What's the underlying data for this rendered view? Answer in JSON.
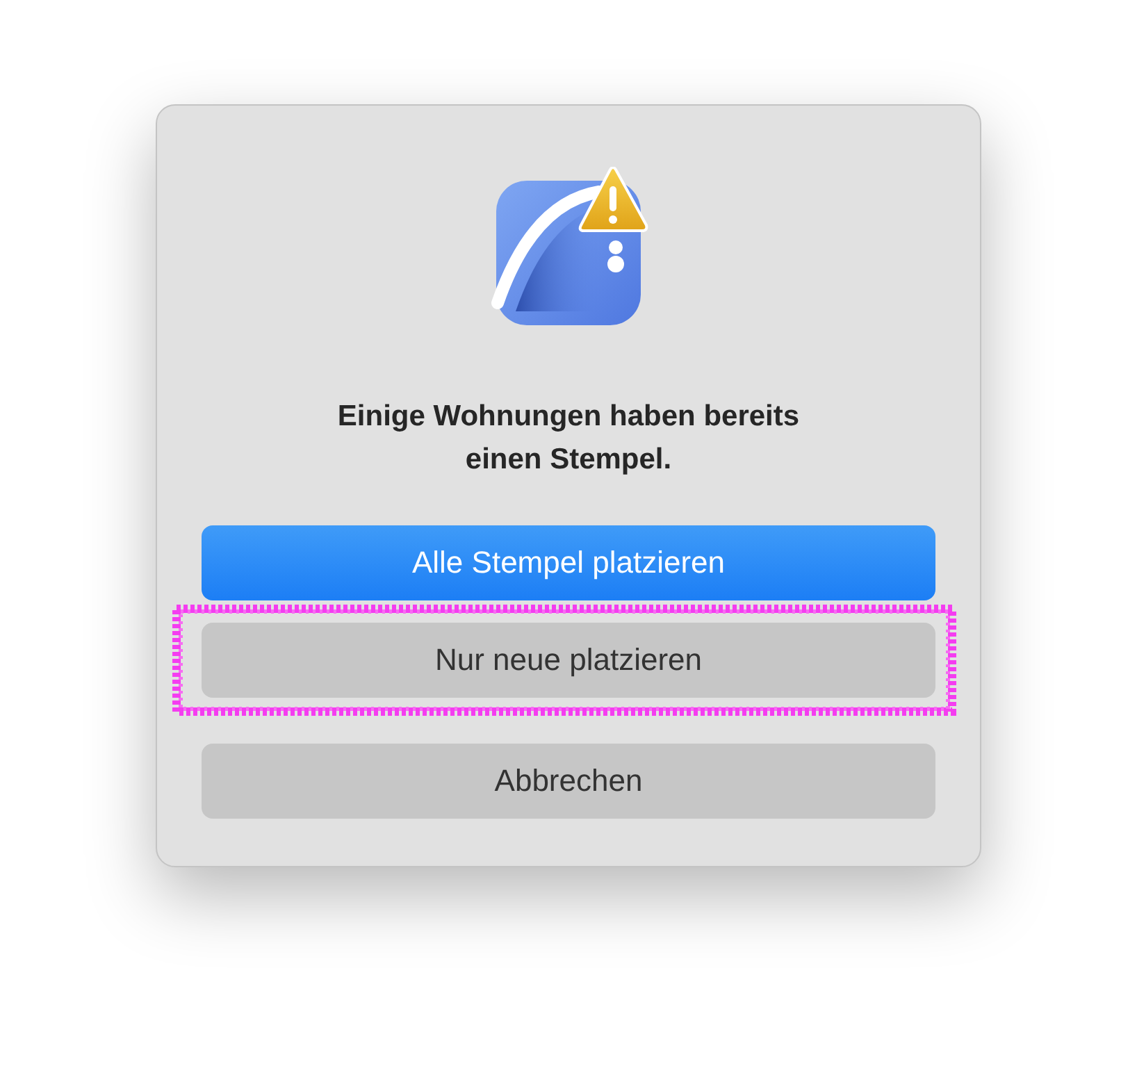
{
  "dialog": {
    "message": "Einige Wohnungen haben bereits einen Stempel.",
    "buttons": [
      {
        "label": "Alle Stempel platzieren",
        "kind": "primary",
        "highlighted": false
      },
      {
        "label": "Nur neue platzieren",
        "kind": "secondary",
        "highlighted": true
      },
      {
        "label": "Abbrechen",
        "kind": "secondary",
        "highlighted": false
      }
    ]
  }
}
